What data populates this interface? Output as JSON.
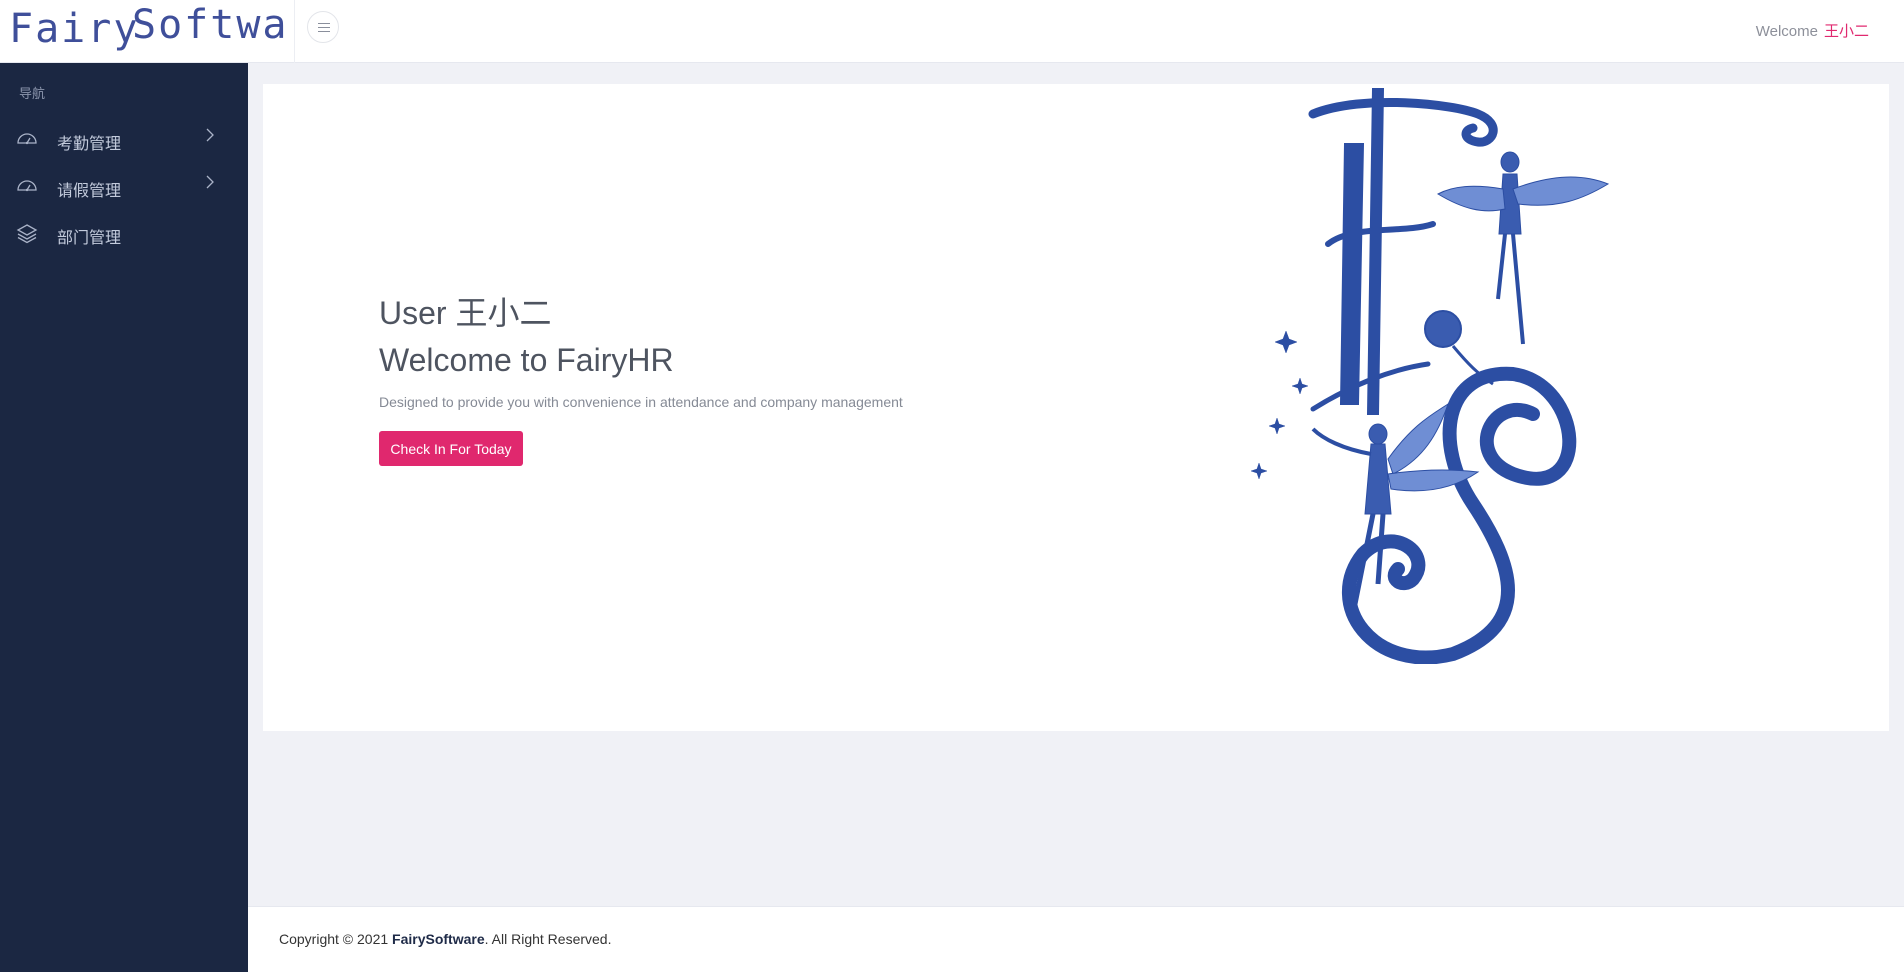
{
  "header": {
    "logo_word1": "Fairy",
    "logo_word2": "Software",
    "welcome_label": "Welcome",
    "user_name": "王小二"
  },
  "sidebar": {
    "heading": "导航",
    "items": [
      {
        "label": "考勤管理",
        "icon": "dashboard-icon",
        "expandable": true
      },
      {
        "label": "请假管理",
        "icon": "dashboard-icon",
        "expandable": true
      },
      {
        "label": "部门管理",
        "icon": "layers-icon",
        "expandable": false
      }
    ]
  },
  "main": {
    "user_line": "User 王小二",
    "title": "Welcome to FairyHR",
    "tagline": "Designed to provide you with convenience in attendance and company management",
    "checkin_button": "Check In For Today",
    "illustration_letters": "FS"
  },
  "footer": {
    "copyright_prefix": "Copyright © 2021",
    "brand": "FairySoftware",
    "suffix": ". All Right Reserved."
  },
  "colors": {
    "accent": "#e0286e",
    "sidebar_bg": "#1b2742",
    "logo": "#3f4f9a",
    "illustration": "#2c4ea3"
  }
}
